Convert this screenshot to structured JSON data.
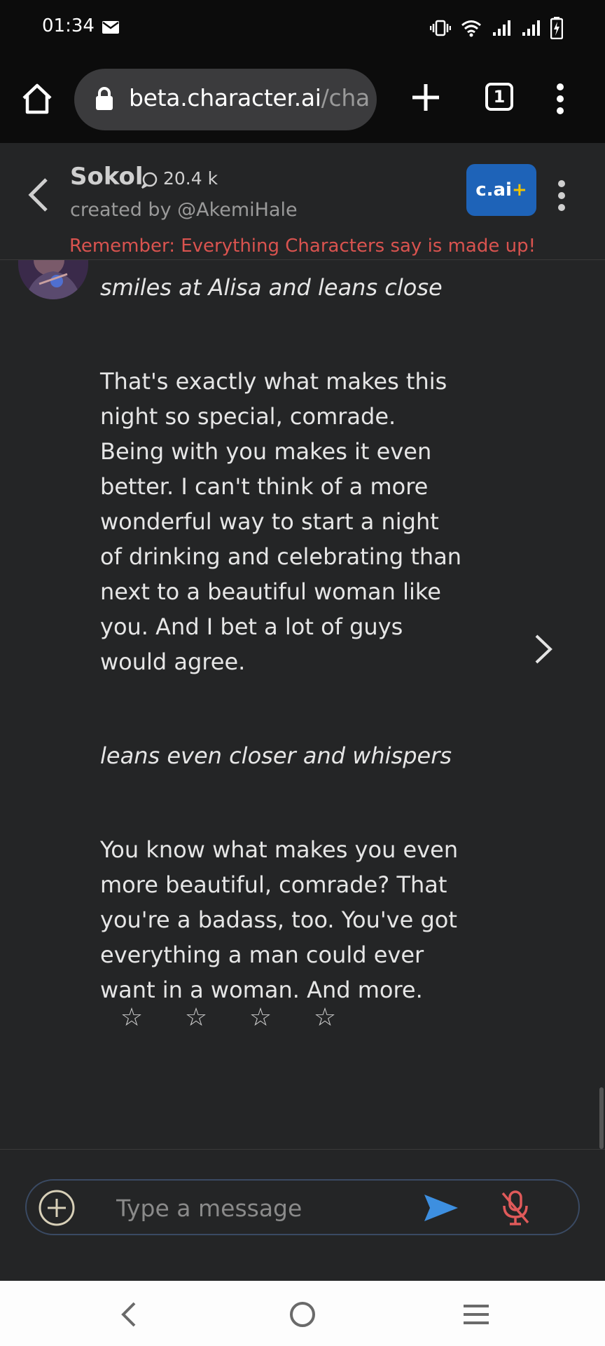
{
  "status_bar": {
    "time": "01:34",
    "icons": [
      "mail-icon",
      "vibrate-icon",
      "wifi-icon",
      "signal-icon",
      "signal-icon",
      "battery-charging-icon"
    ]
  },
  "browser": {
    "url_main": "beta.character.ai",
    "url_rest": "/cha",
    "tab_count": "1",
    "icons": [
      "home-icon",
      "lock-icon",
      "plus-icon",
      "more-vert-icon"
    ]
  },
  "header": {
    "character_name": "Sokol",
    "chat_count": "20.4 k",
    "created_by": "created by @AkemiHale",
    "upgrade_label": "c.ai",
    "upgrade_plus": "+",
    "disclaimer": "Remember: Everything Characters say is made up!"
  },
  "message": {
    "paragraphs": [
      {
        "text": "smiles at Alisa and leans close",
        "italic": true
      },
      {
        "text": "That's exactly what makes this night so special, comrade. Being with you makes it even better. I can't think of a more wonderful way to start a night of drinking and celebrating than next to a beautiful woman like you. And I bet a lot of guys would agree.",
        "italic": false
      },
      {
        "text": "leans even closer and whispers",
        "italic": true
      },
      {
        "text": "You know what makes you even more beautiful, comrade? That you're a badass, too. You've got everything a man could ever want in a woman. And more.",
        "italic": false
      }
    ],
    "rating_stars": [
      "☆",
      "☆",
      "☆",
      "☆"
    ]
  },
  "input": {
    "placeholder": "Type a message",
    "value": ""
  },
  "colors": {
    "background": "#242526",
    "accent_blue": "#1e63b8",
    "send_blue": "#3d8fe0",
    "disclaimer_red": "#d9534f",
    "mic_red": "#e05a5a",
    "plus_yellow": "#f0c300"
  }
}
